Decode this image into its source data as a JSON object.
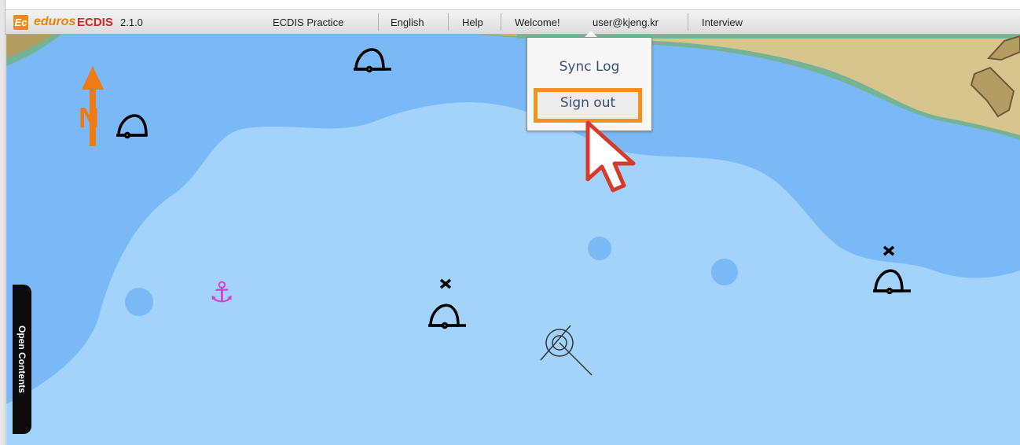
{
  "app": {
    "logo_text": "Ec",
    "brand_name": "eduros",
    "brand_product": "ECDIS",
    "version": "2.1.0"
  },
  "menu": {
    "items": [
      "ECDIS Practice",
      "English",
      "Help",
      "Welcome!",
      "user@kjeng.kr",
      "Interview"
    ]
  },
  "dropdown": {
    "sync_log": "Sync Log",
    "sign_out": "Sign out"
  },
  "side_tab": {
    "label": "Open Contents"
  },
  "map": {
    "north_label": "N",
    "anchor_symbol": "⚓"
  },
  "colors": {
    "brand_orange": "#e8830c",
    "brand_red": "#d2261e",
    "highlight": "#f3921b",
    "deep_water": "#7ab9f5",
    "shallow_water": "#a3d2fb",
    "land": "#d7c58d",
    "shore": "#74b495"
  },
  "icons": [
    "north-arrow-icon",
    "buoy-icon",
    "anchorage-icon",
    "wreck-icon",
    "mouse-pointer-icon"
  ]
}
